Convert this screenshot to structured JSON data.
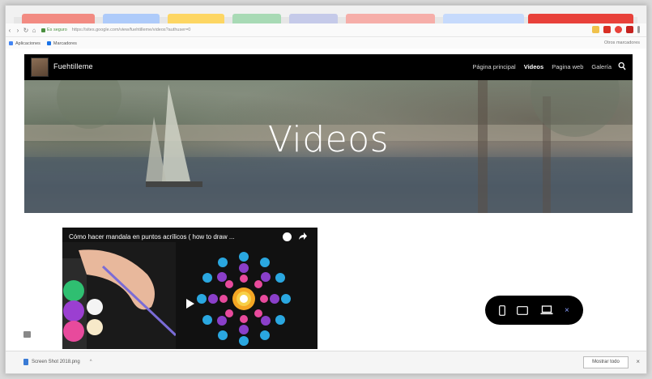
{
  "browser": {
    "secure_label": "Es seguro",
    "url": "https://sites.google.com/view/fuehtilleme/videos?authuser=0",
    "bookmarks": [
      {
        "label": "Aplicaciones",
        "icon": "apps-icon"
      },
      {
        "label": "Marcadores",
        "icon": "bookmark-icon"
      }
    ],
    "other_bookmarks": "Otros marcadores"
  },
  "site": {
    "brand": "Fuehtilleme",
    "menu": [
      {
        "label": "Página principal",
        "active": false
      },
      {
        "label": "Videos",
        "active": true
      },
      {
        "label": "Pagina web",
        "active": false
      },
      {
        "label": "Galería",
        "active": false
      }
    ]
  },
  "hero": {
    "title": "Videos"
  },
  "video": {
    "title": "Cómo hacer mandala en puntos acrílicos ( how to draw ..."
  },
  "downloads": {
    "file_name": "Screen Shot 2018.png",
    "show_all_label": "Mostrar todo"
  },
  "colors": {
    "nav_bg": "#000000",
    "hero_text": "#ffffff",
    "device_bar_bg": "#000000",
    "active_tab_red": "#e8413a"
  }
}
